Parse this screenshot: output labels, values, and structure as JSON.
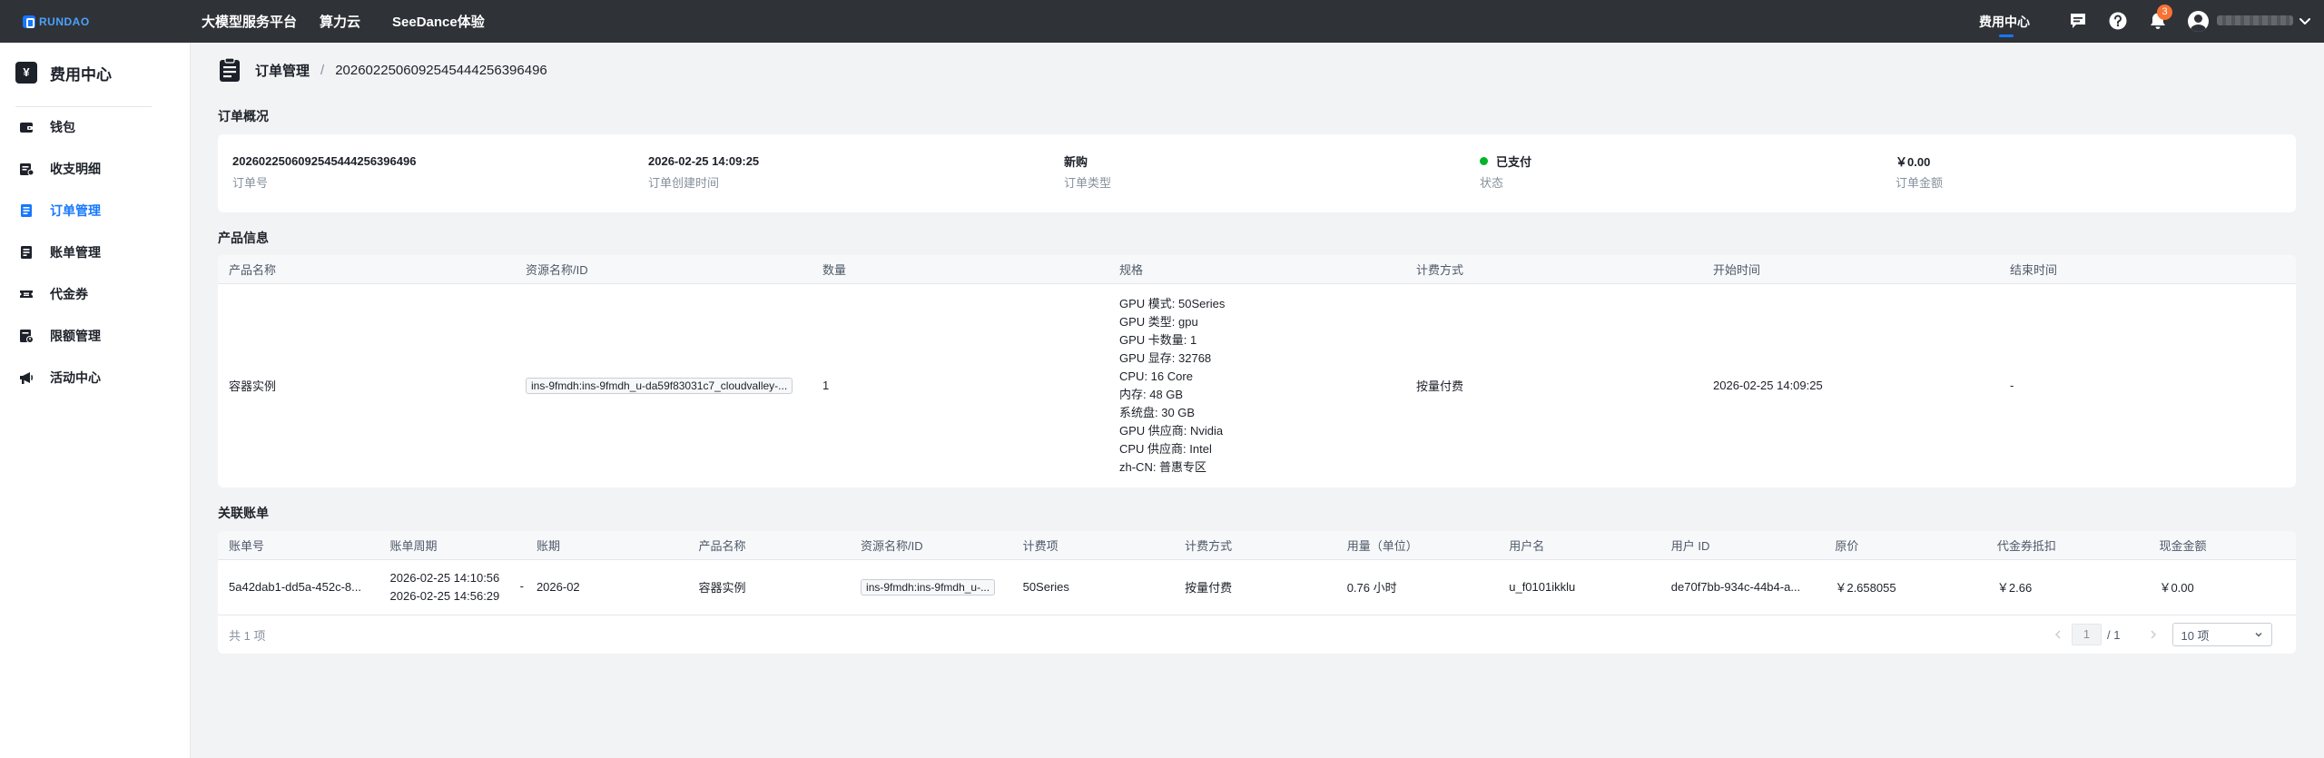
{
  "topbar": {
    "logo_text": "RUNDAO",
    "nav": [
      "大模型服务平台",
      "算力云",
      "SeeDance体验"
    ],
    "right_link": "费用中心",
    "notification_count": "3",
    "icons": [
      "message-icon",
      "help-icon",
      "bell-icon",
      "user-icon",
      "chevron-down-icon"
    ]
  },
  "sidebar": {
    "title": "费用中心",
    "title_icon": "¥",
    "items": [
      {
        "label": "钱包",
        "icon": "wallet-icon"
      },
      {
        "label": "收支明细",
        "icon": "transaction-icon"
      },
      {
        "label": "订单管理",
        "icon": "order-icon",
        "active": true
      },
      {
        "label": "账单管理",
        "icon": "bill-icon"
      },
      {
        "label": "代金券",
        "icon": "coupon-icon"
      },
      {
        "label": "限额管理",
        "icon": "limit-icon"
      },
      {
        "label": "活动中心",
        "icon": "megaphone-icon"
      }
    ]
  },
  "breadcrumb": {
    "parent": "订单管理",
    "separator": "/",
    "current": "20260225060925454442563964​96"
  },
  "overview": {
    "title": "订单概况",
    "items": [
      {
        "value": "20260225060925454442563964​96",
        "label": "订单号"
      },
      {
        "value": "2026-02-25 14:09:25",
        "label": "订单创建时间"
      },
      {
        "value": "新购",
        "label": "订单类型"
      },
      {
        "value": "已支付",
        "label": "状态",
        "status_color": "#00b42a"
      },
      {
        "value": "￥0.00",
        "label": "订单金额"
      }
    ]
  },
  "product": {
    "title": "产品信息",
    "columns": [
      "产品名称",
      "资源名称/ID",
      "数量",
      "规格",
      "计费方式",
      "开始时间",
      "结束时间"
    ],
    "row": {
      "name": "容器实例",
      "resource": "ins-9fmdh:ins-9fmdh_u-da59f83031c7_cloudvalley-...",
      "quantity": "1",
      "spec": [
        "GPU 模式: 50Series",
        "GPU 类型: gpu",
        "GPU 卡数量: 1",
        "GPU 显存: 32768",
        "CPU: 16 Core",
        "内存: 48 GB",
        "系统盘: 30 GB",
        "GPU 供应商: Nvidia",
        "CPU 供应商: Intel",
        "zh-CN: 普惠专区"
      ],
      "billing": "按量付费",
      "start": "2026-02-25 14:09:25",
      "end": "-"
    }
  },
  "bills": {
    "title": "关联账单",
    "columns": [
      "账单号",
      "账单周期",
      "账期",
      "产品名称",
      "资源名称/ID",
      "计费项",
      "计费方式",
      "用量（单位）",
      "用户名",
      "用户 ID",
      "原价",
      "代金券抵扣",
      "现金金额"
    ],
    "row": {
      "bill_no": "5a42dab1-dd5a-452c-8...",
      "period_start": "2026-02-25 14:10:56",
      "period_end": "2026-02-25 14:56:29",
      "period_dash": "-",
      "month": "2026-02",
      "product": "容器实例",
      "resource": "ins-9fmdh:ins-9fmdh_u-...",
      "item": "50Series",
      "billing": "按量付费",
      "usage": "0.76 小时",
      "username": "u_f0101ikklu",
      "user_id": "de70f7bb-934c-44b4-a...",
      "original": "￥2.658055",
      "coupon": "￥2.66",
      "cash": "￥0.00"
    },
    "footer": {
      "total": "共 1 项",
      "page": "1",
      "page_total": "/ 1",
      "page_size": "10 项"
    }
  },
  "colors": {
    "topbar": "#2f3237",
    "accent": "#1677ff",
    "badge": "#f77234",
    "status_paid": "#00b42a"
  }
}
